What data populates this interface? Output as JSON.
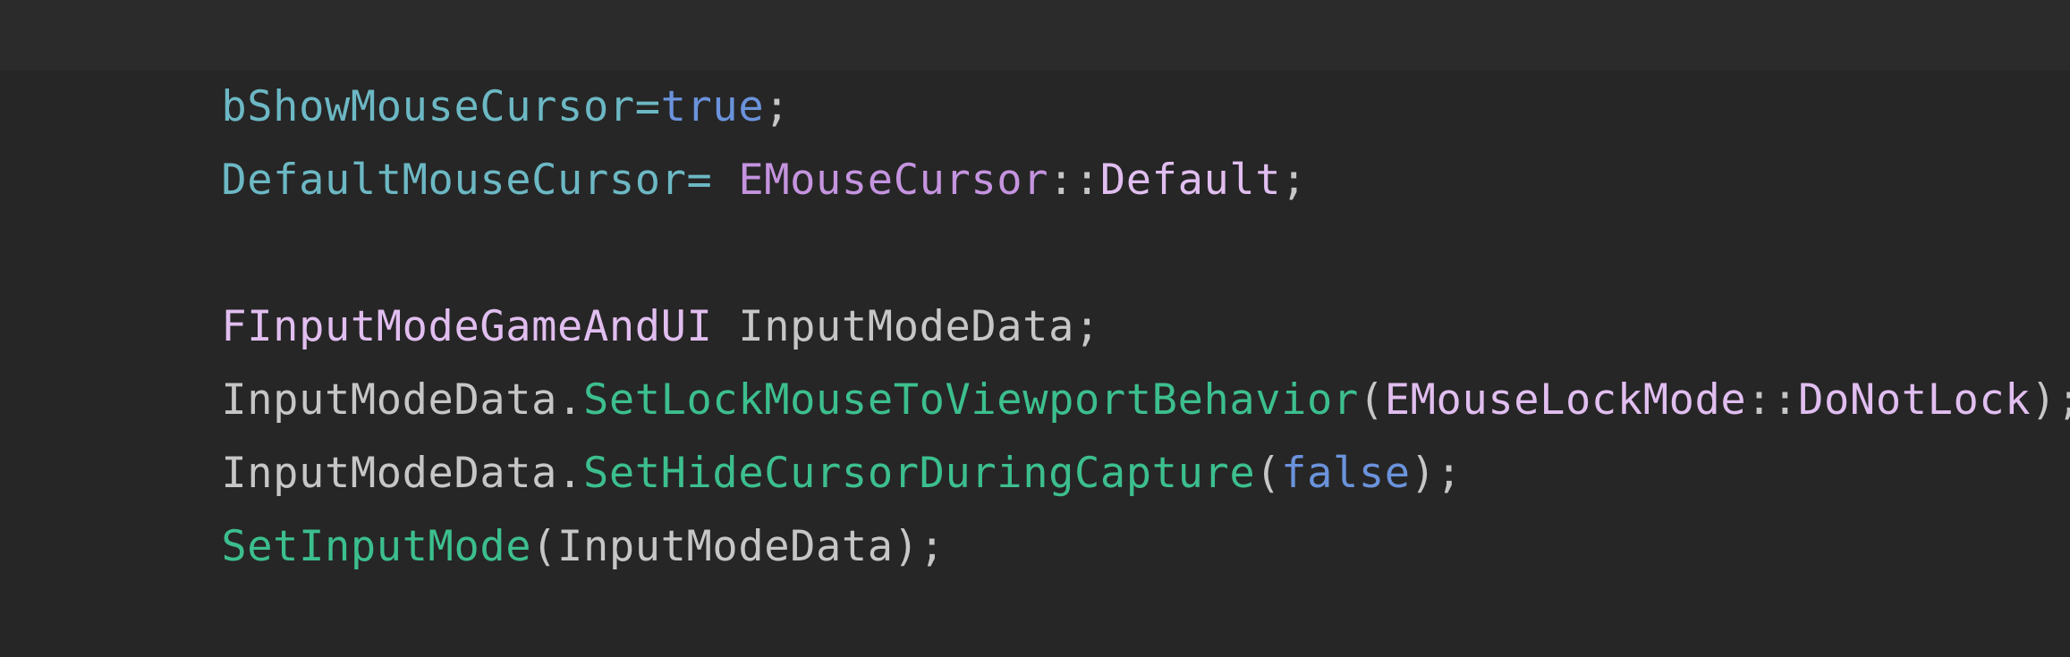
{
  "editor": {
    "colors": {
      "background": "#262626",
      "current_line": "#2b2b2b",
      "field": "#6cb8c4",
      "keyword": "#6b93dc",
      "type": "#c594e0",
      "enum_member": "#e1bef0",
      "method": "#3cbf8e",
      "plain": "#c6c6c6",
      "punctuation": "#c6c6c6"
    },
    "lines": [
      {
        "current": true,
        "tokens": [
          {
            "text": "bShowMouseCursor",
            "kind": "field"
          },
          {
            "text": "=",
            "kind": "field"
          },
          {
            "text": "true",
            "kind": "keyword"
          },
          {
            "text": ";",
            "kind": "punctuation"
          }
        ]
      },
      {
        "current": false,
        "tokens": [
          {
            "text": "DefaultMouseCursor",
            "kind": "field"
          },
          {
            "text": "= ",
            "kind": "field"
          },
          {
            "text": "EMouseCursor",
            "kind": "type"
          },
          {
            "text": "::",
            "kind": "punctuation"
          },
          {
            "text": "Default",
            "kind": "enum_member"
          },
          {
            "text": ";",
            "kind": "punctuation"
          }
        ]
      },
      {
        "current": false,
        "tokens": []
      },
      {
        "current": false,
        "tokens": [
          {
            "text": "FInputModeGameAndUI",
            "kind": "enum_member"
          },
          {
            "text": " InputModeData;",
            "kind": "plain"
          }
        ]
      },
      {
        "current": false,
        "tokens": [
          {
            "text": "InputModeData.",
            "kind": "plain"
          },
          {
            "text": "SetLockMouseToViewportBehavior",
            "kind": "method"
          },
          {
            "text": "(",
            "kind": "punctuation"
          },
          {
            "text": "EMouseLockMode",
            "kind": "enum_member"
          },
          {
            "text": "::",
            "kind": "punctuation"
          },
          {
            "text": "DoNotLock",
            "kind": "enum_member"
          },
          {
            "text": ");",
            "kind": "punctuation"
          }
        ]
      },
      {
        "current": false,
        "tokens": [
          {
            "text": "InputModeData.",
            "kind": "plain"
          },
          {
            "text": "SetHideCursorDuringCapture",
            "kind": "method"
          },
          {
            "text": "(",
            "kind": "punctuation"
          },
          {
            "text": "false",
            "kind": "keyword"
          },
          {
            "text": ");",
            "kind": "punctuation"
          }
        ]
      },
      {
        "current": false,
        "tokens": [
          {
            "text": "SetInputMode",
            "kind": "method"
          },
          {
            "text": "(InputModeData);",
            "kind": "plain"
          }
        ]
      }
    ]
  }
}
